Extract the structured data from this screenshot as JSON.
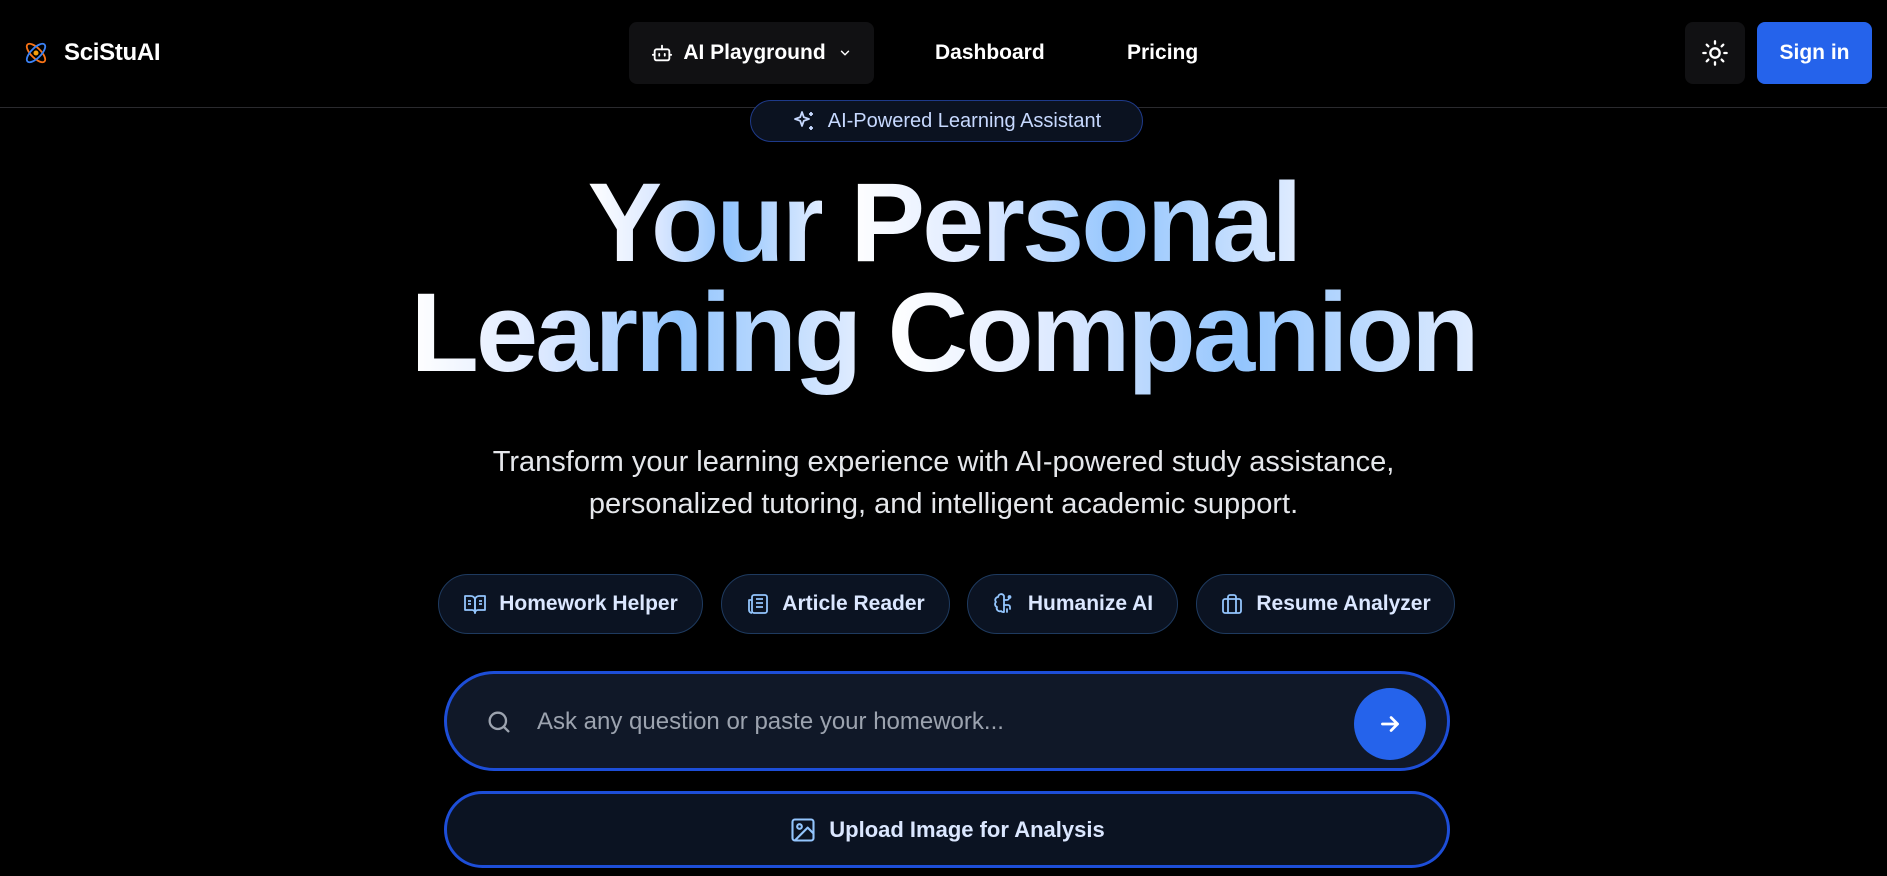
{
  "header": {
    "brand": "SciStuAI",
    "nav": {
      "playground_label": "AI Playground",
      "dashboard_label": "Dashboard",
      "pricing_label": "Pricing"
    },
    "sign_in_label": "Sign in"
  },
  "hero": {
    "badge_label": "AI-Powered Learning Assistant",
    "title": {
      "line1_word1": "Your",
      "line1_word2": "Personal",
      "line2_word1": "Learning",
      "line2_word2": "Companion"
    },
    "subtitle_line1": "Transform your learning experience with AI-powered study assistance,",
    "subtitle_line2": "personalized tutoring, and intelligent academic support."
  },
  "features": [
    {
      "label": "Homework Helper",
      "icon": "book-open-icon"
    },
    {
      "label": "Article Reader",
      "icon": "newspaper-icon"
    },
    {
      "label": "Humanize AI",
      "icon": "brain-icon"
    },
    {
      "label": "Resume Analyzer",
      "icon": "briefcase-icon"
    }
  ],
  "search": {
    "placeholder": "Ask any question or paste your homework...",
    "value": ""
  },
  "upload_label": "Upload Image for Analysis",
  "colors": {
    "background": "#000000",
    "accent": "#2563eb",
    "accent_border": "#1d4ed8",
    "gradient_light": "#93c5fd"
  }
}
